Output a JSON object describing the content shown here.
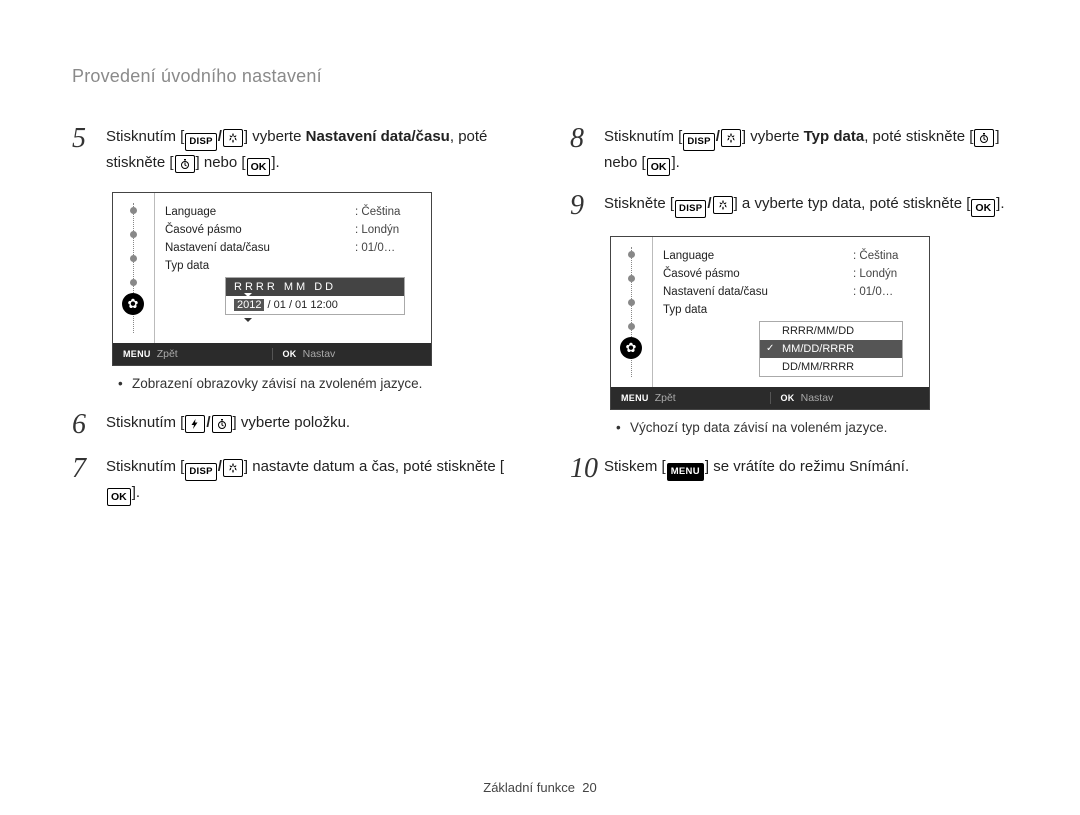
{
  "page_title": "Provedení úvodního nastavení",
  "keys": {
    "disp": "DISP",
    "ok": "OK",
    "menu_full": "MENU",
    "menu_footer": "MENU",
    "ok_footer": "OK"
  },
  "steps": {
    "5": {
      "t1": "Stisknutím [",
      "t2": "] vyberte ",
      "bold": "Nastavení data/času",
      "t3": ", poté stiskněte [",
      "t4": "] nebo [",
      "t5": "]."
    },
    "6": {
      "t1": "Stisknutím [",
      "t2": "] vyberte položku."
    },
    "7": {
      "t1": "Stisknutím [",
      "t2": "] nastavte datum a čas, poté stiskněte [",
      "t3": "]."
    },
    "8": {
      "t1": "Stisknutím [",
      "t2": "] vyberte ",
      "bold": "Typ data",
      "t3": ", poté stiskněte [",
      "t4": "] nebo [",
      "t5": "]."
    },
    "9": {
      "t1": "Stiskněte [",
      "t2": "] a vyberte typ data, poté stiskněte [",
      "t3": "]."
    },
    "10": {
      "t1": "Stiskem [",
      "t2": "] se vrátíte do režimu Snímání."
    }
  },
  "screenA": {
    "rows": {
      "language_label": "Language",
      "language_value": ": Čeština",
      "tz_label": "Časové pásmo",
      "tz_value": ": Londýn",
      "dt_label": "Nastavení data/času",
      "dt_value": ": 01/0…",
      "type_label": "Typ data"
    },
    "date_header": "RRRR MM DD",
    "date_year": "2012",
    "date_rest": " / 01 / 01 12:00",
    "footer_back": "Zpět",
    "footer_set": "Nastav"
  },
  "screenB": {
    "rows": {
      "language_label": "Language",
      "language_value": ": Čeština",
      "tz_label": "Časové pásmo",
      "tz_value": ": Londýn",
      "dt_label": "Nastavení data/času",
      "dt_value": ": 01/0…",
      "type_label": "Typ data"
    },
    "opt1": "RRRR/MM/DD",
    "opt2": "MM/DD/RRRR",
    "opt3": "DD/MM/RRRR",
    "footer_back": "Zpět",
    "footer_set": "Nastav"
  },
  "notes": {
    "left": "Zobrazení obrazovky závisí na zvoleném jazyce.",
    "right": "Výchozí typ data závisí na voleném jazyce."
  },
  "footer": {
    "section": "Základní funkce",
    "page": "20"
  }
}
